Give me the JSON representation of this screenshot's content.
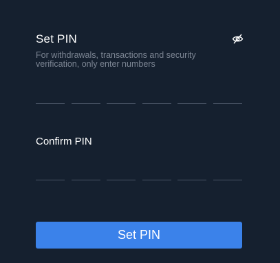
{
  "set_pin": {
    "title": "Set PIN",
    "hint": "For withdrawals, transactions and security verification, only enter numbers",
    "visibility_icon": "eye-off-icon",
    "digits": [
      "",
      "",
      "",
      "",
      "",
      ""
    ]
  },
  "confirm_pin": {
    "label": "Confirm PIN",
    "digits": [
      "",
      "",
      "",
      "",
      "",
      ""
    ]
  },
  "submit": {
    "label": "Set PIN"
  },
  "colors": {
    "background": "#15202f",
    "accent": "#3b82ea",
    "hint_text": "#7c8593",
    "underline": "#4a5566"
  }
}
